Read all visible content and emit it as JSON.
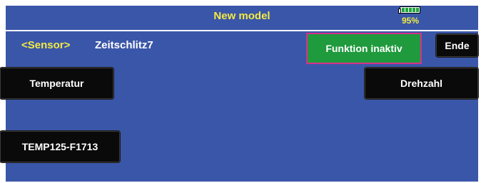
{
  "header": {
    "title": "New model",
    "battery": {
      "percent_label": "95%",
      "level": 0.95,
      "cells": 5
    }
  },
  "sensor": {
    "label": "<Sensor>",
    "value": "Zeitschlitz7"
  },
  "status_button": {
    "label": "Funktion inaktiv",
    "color": "#1f9a3d",
    "border_color": "#d8308a"
  },
  "buttons": {
    "ende": "Ende",
    "temperatur": "Temperatur",
    "drehzahl": "Drehzahl",
    "temp_sensor": "TEMP125-F1713"
  },
  "colors": {
    "background": "#3a56a8",
    "accent_text": "#f2ea45"
  }
}
